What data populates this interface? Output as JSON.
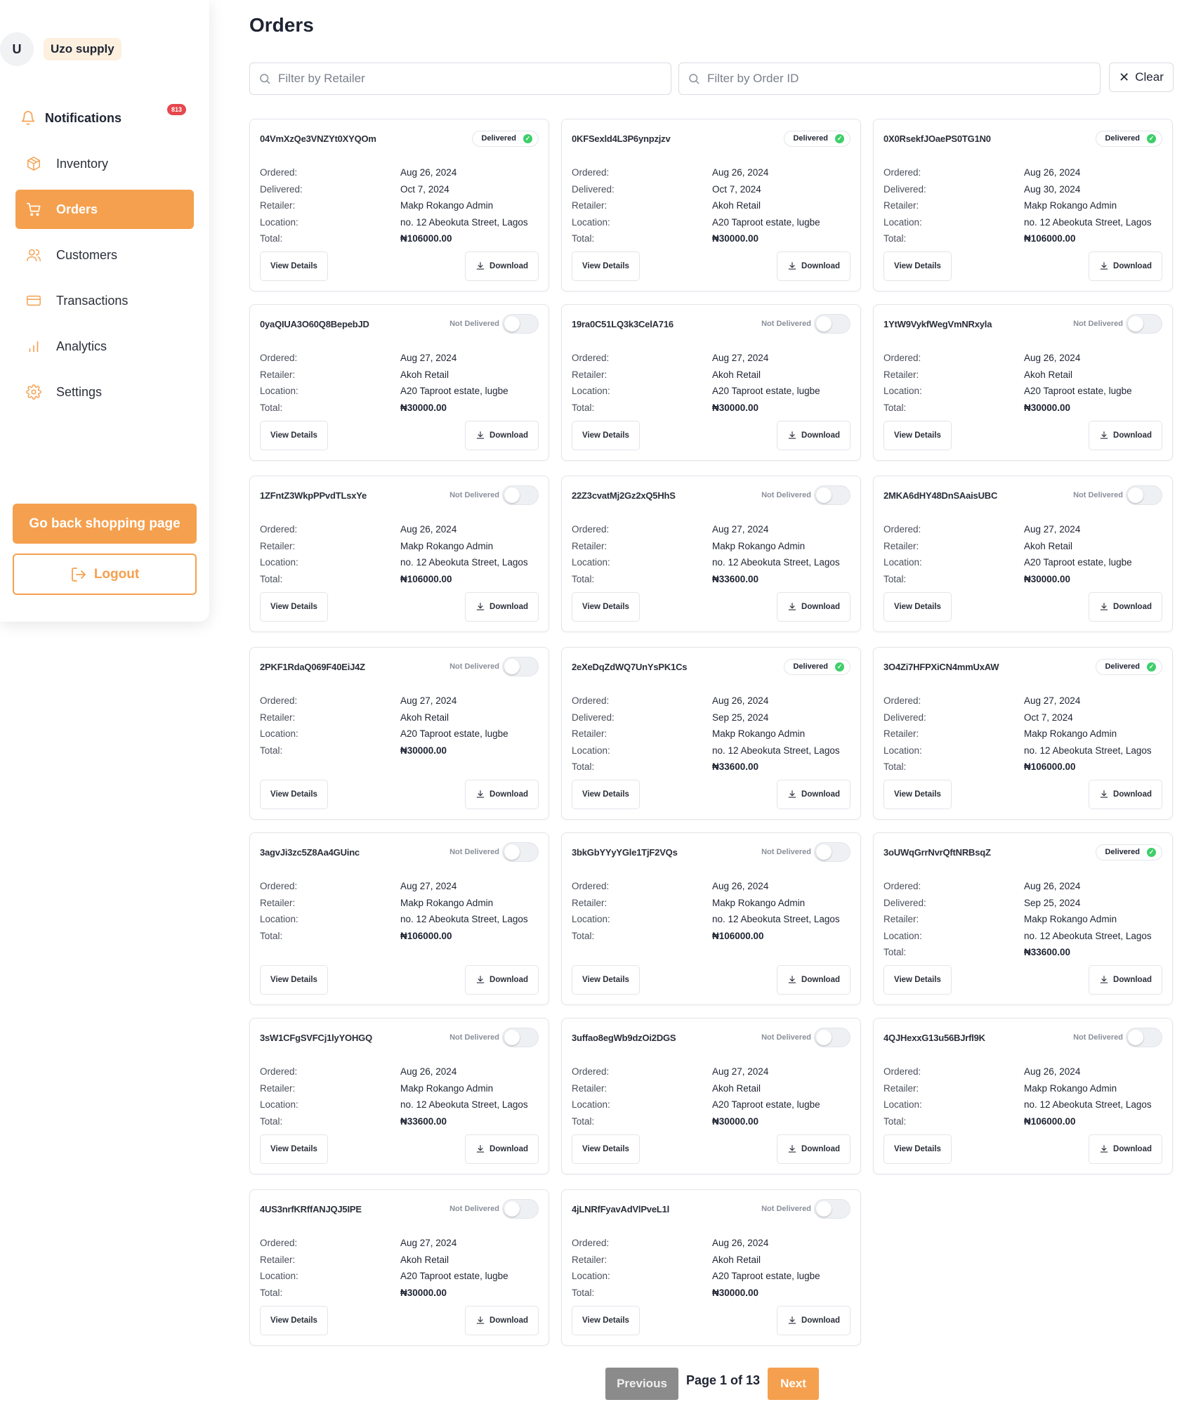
{
  "profile": {
    "avatar_initial": "U",
    "store_name": "Uzo supply"
  },
  "sidebar": {
    "notifications": {
      "label": "Notifications",
      "badge": "813"
    },
    "items": [
      {
        "label": "Inventory",
        "icon": "box-icon"
      },
      {
        "label": "Orders",
        "icon": "cart-icon",
        "active": true
      },
      {
        "label": "Customers",
        "icon": "users-icon"
      },
      {
        "label": "Transactions",
        "icon": "card-icon"
      },
      {
        "label": "Analytics",
        "icon": "bar-chart-icon"
      },
      {
        "label": "Settings",
        "icon": "gear-icon"
      }
    ],
    "shop_button": "Go back shopping page",
    "logout_button": "Logout"
  },
  "page": {
    "title": "Orders"
  },
  "filters": {
    "retailer_placeholder": "Filter by Retailer",
    "order_placeholder": "Filter by Order ID",
    "clear_label": "Clear"
  },
  "labels": {
    "ordered": "Ordered:",
    "delivered": "Delivered:",
    "retailer": "Retailer:",
    "location": "Location:",
    "total": "Total:",
    "view_details": "View Details",
    "download": "Download",
    "status_delivered": "Delivered",
    "status_not_delivered": "Not Delivered"
  },
  "orders": [
    {
      "id": "04VmXzQe3VNZYt0XYQOm",
      "delivered": true,
      "ordered": "Aug 26, 2024",
      "delivered_date": "Oct 7, 2024",
      "retailer": "Makp Rokango Admin",
      "location": "no. 12 Abeokuta Street, Lagos",
      "total": "₦106000.00"
    },
    {
      "id": "0KFSexld4L3P6ynpzjzv",
      "delivered": true,
      "ordered": "Aug 26, 2024",
      "delivered_date": "Oct 7, 2024",
      "retailer": "Akoh Retail",
      "location": "A20 Taproot estate, lugbe",
      "total": "₦30000.00"
    },
    {
      "id": "0X0RsekfJOaePS0TG1N0",
      "delivered": true,
      "ordered": "Aug 26, 2024",
      "delivered_date": "Aug 30, 2024",
      "retailer": "Makp Rokango Admin",
      "location": "no. 12 Abeokuta Street, Lagos",
      "total": "₦106000.00"
    },
    {
      "id": "0yaQIUA3O60Q8BepebJD",
      "delivered": false,
      "ordered": "Aug 27, 2024",
      "retailer": "Akoh Retail",
      "location": "A20 Taproot estate, lugbe",
      "total": "₦30000.00"
    },
    {
      "id": "19ra0C51LQ3k3CelA716",
      "delivered": false,
      "ordered": "Aug 27, 2024",
      "retailer": "Akoh Retail",
      "location": "A20 Taproot estate, lugbe",
      "total": "₦30000.00"
    },
    {
      "id": "1YtW9VykfWegVmNRxyla",
      "delivered": false,
      "ordered": "Aug 26, 2024",
      "retailer": "Akoh Retail",
      "location": "A20 Taproot estate, lugbe",
      "total": "₦30000.00"
    },
    {
      "id": "1ZFntZ3WkpPPvdTLsxYe",
      "delivered": false,
      "ordered": "Aug 26, 2024",
      "retailer": "Makp Rokango Admin",
      "location": "no. 12 Abeokuta Street, Lagos",
      "total": "₦106000.00"
    },
    {
      "id": "22Z3cvatMj2Gz2xQ5HhS",
      "delivered": false,
      "ordered": "Aug 27, 2024",
      "retailer": "Makp Rokango Admin",
      "location": "no. 12 Abeokuta Street, Lagos",
      "total": "₦33600.00"
    },
    {
      "id": "2MKA6dHY48DnSAaisUBC",
      "delivered": false,
      "ordered": "Aug 27, 2024",
      "retailer": "Akoh Retail",
      "location": "A20 Taproot estate, lugbe",
      "total": "₦30000.00"
    },
    {
      "id": "2PKF1RdaQ069F40EiJ4Z",
      "delivered": false,
      "ordered": "Aug 27, 2024",
      "retailer": "Akoh Retail",
      "location": "A20 Taproot estate, lugbe",
      "total": "₦30000.00"
    },
    {
      "id": "2eXeDqZdWQ7UnYsPK1Cs",
      "delivered": true,
      "ordered": "Aug 26, 2024",
      "delivered_date": "Sep 25, 2024",
      "retailer": "Makp Rokango Admin",
      "location": "no. 12 Abeokuta Street, Lagos",
      "total": "₦33600.00"
    },
    {
      "id": "3O4Zi7HFPXiCN4mmUxAW",
      "delivered": true,
      "ordered": "Aug 27, 2024",
      "delivered_date": "Oct 7, 2024",
      "retailer": "Makp Rokango Admin",
      "location": "no. 12 Abeokuta Street, Lagos",
      "total": "₦106000.00"
    },
    {
      "id": "3agvJi3zc5Z8Aa4GUinc",
      "delivered": false,
      "ordered": "Aug 27, 2024",
      "retailer": "Makp Rokango Admin",
      "location": "no. 12 Abeokuta Street, Lagos",
      "total": "₦106000.00"
    },
    {
      "id": "3bkGbYYyYGle1TjF2VQs",
      "delivered": false,
      "ordered": "Aug 26, 2024",
      "retailer": "Makp Rokango Admin",
      "location": "no. 12 Abeokuta Street, Lagos",
      "total": "₦106000.00"
    },
    {
      "id": "3oUWqGrrNvrQftNRBsqZ",
      "delivered": true,
      "ordered": "Aug 26, 2024",
      "delivered_date": "Sep 25, 2024",
      "retailer": "Makp Rokango Admin",
      "location": "no. 12 Abeokuta Street, Lagos",
      "total": "₦33600.00"
    },
    {
      "id": "3sW1CFgSVFCj1lyYOHGQ",
      "delivered": false,
      "ordered": "Aug 26, 2024",
      "retailer": "Makp Rokango Admin",
      "location": "no. 12 Abeokuta Street, Lagos",
      "total": "₦33600.00"
    },
    {
      "id": "3uffao8egWb9dzOi2DGS",
      "delivered": false,
      "ordered": "Aug 27, 2024",
      "retailer": "Akoh Retail",
      "location": "A20 Taproot estate, lugbe",
      "total": "₦30000.00"
    },
    {
      "id": "4QJHexxG13u56BJrfl9K",
      "delivered": false,
      "ordered": "Aug 26, 2024",
      "retailer": "Makp Rokango Admin",
      "location": "no. 12 Abeokuta Street, Lagos",
      "total": "₦106000.00"
    },
    {
      "id": "4US3nrfKRffANJQJ5IPE",
      "delivered": false,
      "ordered": "Aug 27, 2024",
      "retailer": "Akoh Retail",
      "location": "A20 Taproot estate, lugbe",
      "total": "₦30000.00"
    },
    {
      "id": "4jLNRfFyavAdVlPveL1l",
      "delivered": false,
      "ordered": "Aug 26, 2024",
      "retailer": "Akoh Retail",
      "location": "A20 Taproot estate, lugbe",
      "total": "₦30000.00"
    }
  ],
  "pagination": {
    "previous": "Previous",
    "page_info": "Page 1 of 13",
    "next": "Next"
  },
  "colors": {
    "accent": "#f5a04e",
    "delivered_dot": "#3ecf6a",
    "badge": "#e5484d",
    "previous_button": "#8b8b8b"
  }
}
